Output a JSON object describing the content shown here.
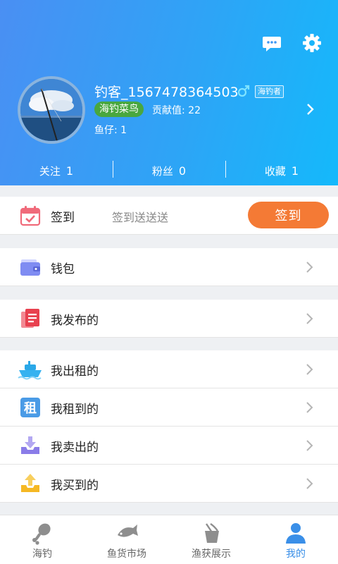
{
  "colors": {
    "header_gradient_start": "#4a8ff3",
    "header_gradient_end": "#14b9fb",
    "checkin_button": "#f47a35",
    "level_badge": "#49a73f",
    "active_tab": "#3a8fe8"
  },
  "header": {
    "icons": [
      "message-icon",
      "settings-gear-icon"
    ]
  },
  "profile": {
    "nickname": "钓客_1567478364503",
    "gender_icon": "male-icon",
    "role_badge": "海钓者",
    "level_badge": "海钓菜鸟",
    "contribution": "贡献值: 22",
    "fish_fry": "鱼仔: 1"
  },
  "stats": [
    {
      "label": "关注",
      "value": "1"
    },
    {
      "label": "粉丝",
      "value": "0"
    },
    {
      "label": "收藏",
      "value": "1"
    }
  ],
  "checkin": {
    "icon": "calendar-check-icon",
    "label": "签到",
    "subtitle": "签到送送送",
    "button": "签到"
  },
  "menu": {
    "wallet": {
      "icon": "wallet-icon",
      "label": "钱包"
    },
    "published": {
      "icon": "documents-icon",
      "label": "我发布的"
    },
    "rented_out": {
      "icon": "boat-icon",
      "label": "我出租的"
    },
    "rented_in": {
      "icon": "rent-icon",
      "rent_char": "租",
      "label": "我租到的"
    },
    "sold": {
      "icon": "tray-download-icon",
      "label": "我卖出的"
    },
    "bought": {
      "icon": "tray-upload-icon",
      "label": "我买到的"
    }
  },
  "tabs": [
    {
      "icon": "drumstick-icon",
      "label": "海钓",
      "active": false
    },
    {
      "icon": "fish-icon",
      "label": "鱼货市场",
      "active": false
    },
    {
      "icon": "catch-bag-icon",
      "label": "渔获展示",
      "active": false
    },
    {
      "icon": "person-icon",
      "label": "我的",
      "active": true
    }
  ]
}
